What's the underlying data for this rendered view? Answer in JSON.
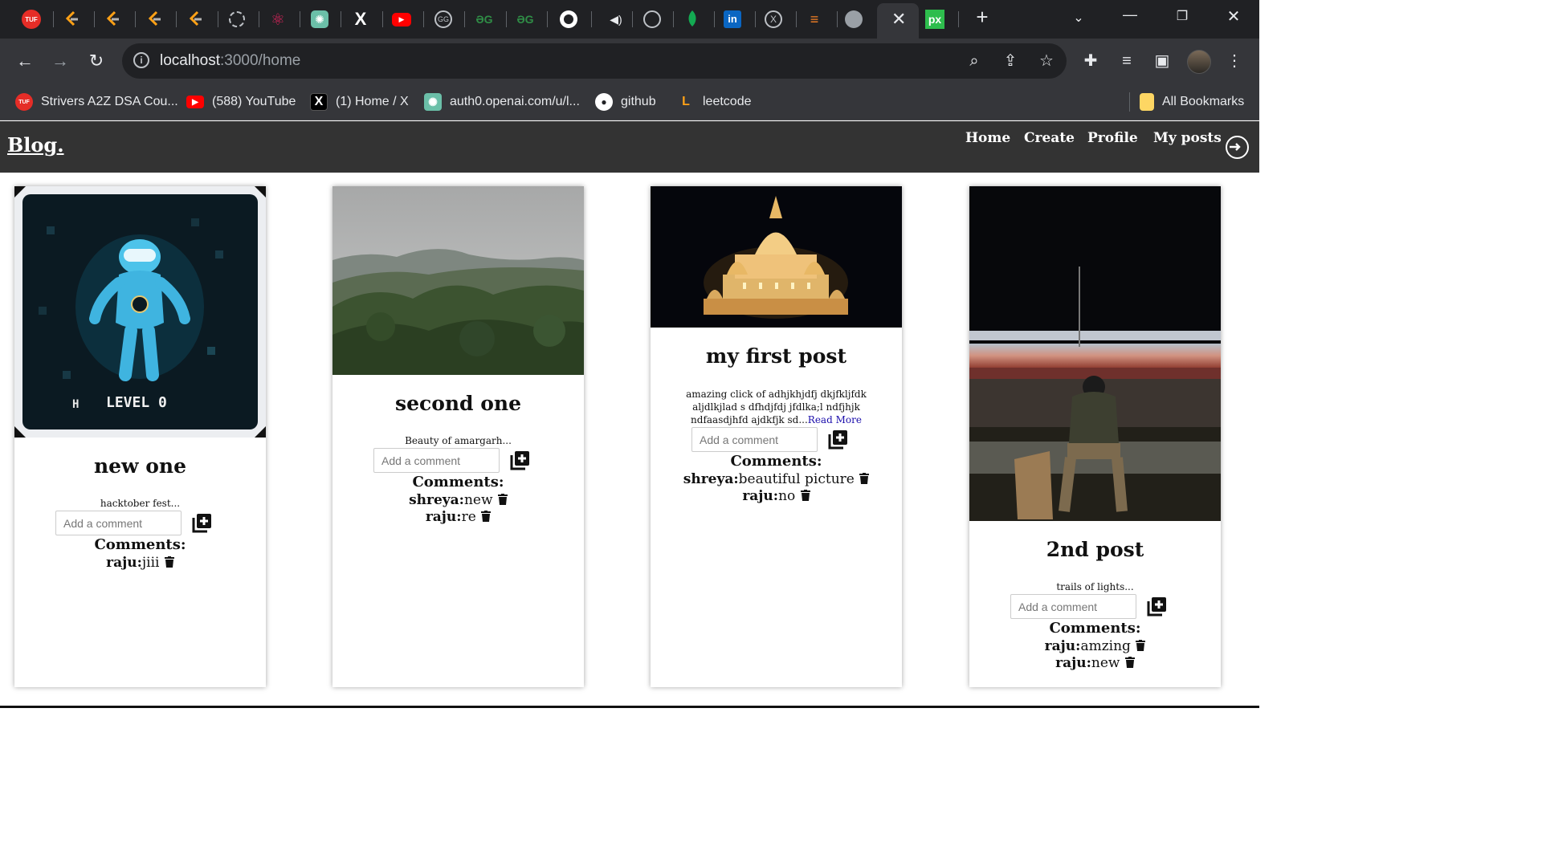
{
  "browser": {
    "active_tab_close": "✕",
    "url_host": "localhost",
    "url_rest": ":3000/home",
    "bookmarks": [
      {
        "label": "Strivers A2Z DSA Cou...",
        "icon": "tuf-icon",
        "color": "#e52d27",
        "badge": "TUF"
      },
      {
        "label": "(588) YouTube",
        "icon": "youtube-icon",
        "color": "#ff0000",
        "badge": "▶"
      },
      {
        "label": "(1) Home / X",
        "icon": "x-icon",
        "color": "#000000",
        "badge": "X"
      },
      {
        "label": "auth0.openai.com/u/l...",
        "icon": "openai-icon",
        "color": "#19a37f",
        "badge": "✺"
      },
      {
        "label": "github",
        "icon": "github-icon",
        "color": "#000000",
        "badge": "●"
      },
      {
        "label": "leetcode",
        "icon": "leetcode-icon",
        "color": "#ffa116",
        "badge": "L"
      }
    ],
    "all_bookmarks": "All Bookmarks"
  },
  "site": {
    "brand": "Blog.",
    "nav": [
      "Home",
      "Create",
      "Profile",
      "My posts"
    ]
  },
  "comment_placeholder": "Add a comment",
  "comments_heading": "Comments:",
  "posts": [
    {
      "title": "new one",
      "desc": "hacktober fest...",
      "image": "hacktoberfest-level0-badge",
      "badge_text": "LEVEL 0",
      "comments": [
        {
          "user": "raju:",
          "text": "jiii"
        }
      ]
    },
    {
      "title": "second one",
      "desc": "Beauty of amargarh...",
      "image": "forest-hills-landscape",
      "comments": [
        {
          "user": "shreya:",
          "text": "new"
        },
        {
          "user": "raju:",
          "text": "re"
        }
      ]
    },
    {
      "title": "my first post",
      "desc": "amazing click of adhjkhjdfj dkjfkljfdk aljdlkjlad s dfhdjfdj jfdlka;l ndfjhjk ndfaasdjhfd ajdkfjk sd...",
      "read_more": "Read More",
      "image": "temple-at-night",
      "comments": [
        {
          "user": "shreya:",
          "text": "beautiful picture"
        },
        {
          "user": "raju:",
          "text": "no"
        }
      ]
    },
    {
      "title": "2nd post",
      "desc": "trails of lights...",
      "image": "light-trails-person-sitting",
      "comments": [
        {
          "user": "raju:",
          "text": "amzing"
        },
        {
          "user": "raju:",
          "text": "new"
        }
      ]
    }
  ]
}
